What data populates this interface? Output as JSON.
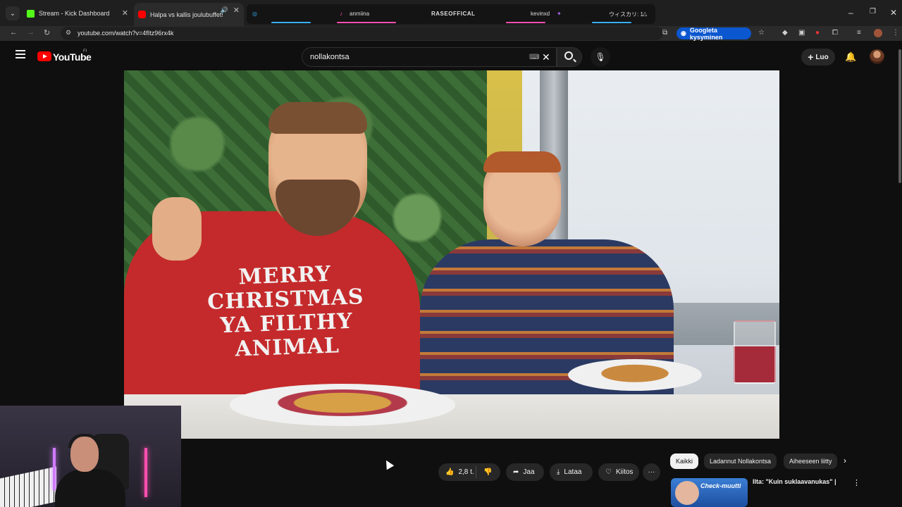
{
  "browser": {
    "tabs": [
      {
        "title": "Stream - Kick Dashboard",
        "favicon_color": "#53fc18"
      },
      {
        "title": "Halpa vs kallis joulubuffet!",
        "favicon_color": "#ff0000"
      }
    ],
    "tab_group": {
      "labels": [
        "anmiina",
        "RASEOFFICAL",
        "kevinxd",
        "ウィスカリ: 1"
      ]
    },
    "url": "youtube.com/watch?v=4fItz96rx4k",
    "google_chip": "Googleta kysyminen"
  },
  "youtube": {
    "brand": "YouTube",
    "region": "FI",
    "search_query": "nollakontsa",
    "create_label": "Luo"
  },
  "video": {
    "sweater_text": "MERRY CHRISTMAS YA FILTHY ANIMAL"
  },
  "actions": {
    "likes": "2,8 t.",
    "share": "Jaa",
    "download": "Lataa",
    "thanks": "Kiitos"
  },
  "chips": [
    "Kaikki",
    "Ladannut Nollakontsa",
    "Aiheeseen liitty"
  ],
  "recommendation": {
    "thumb_text": "Check-muutti",
    "title": "Ilta: \"Kuin suklaavanukas\" |"
  }
}
